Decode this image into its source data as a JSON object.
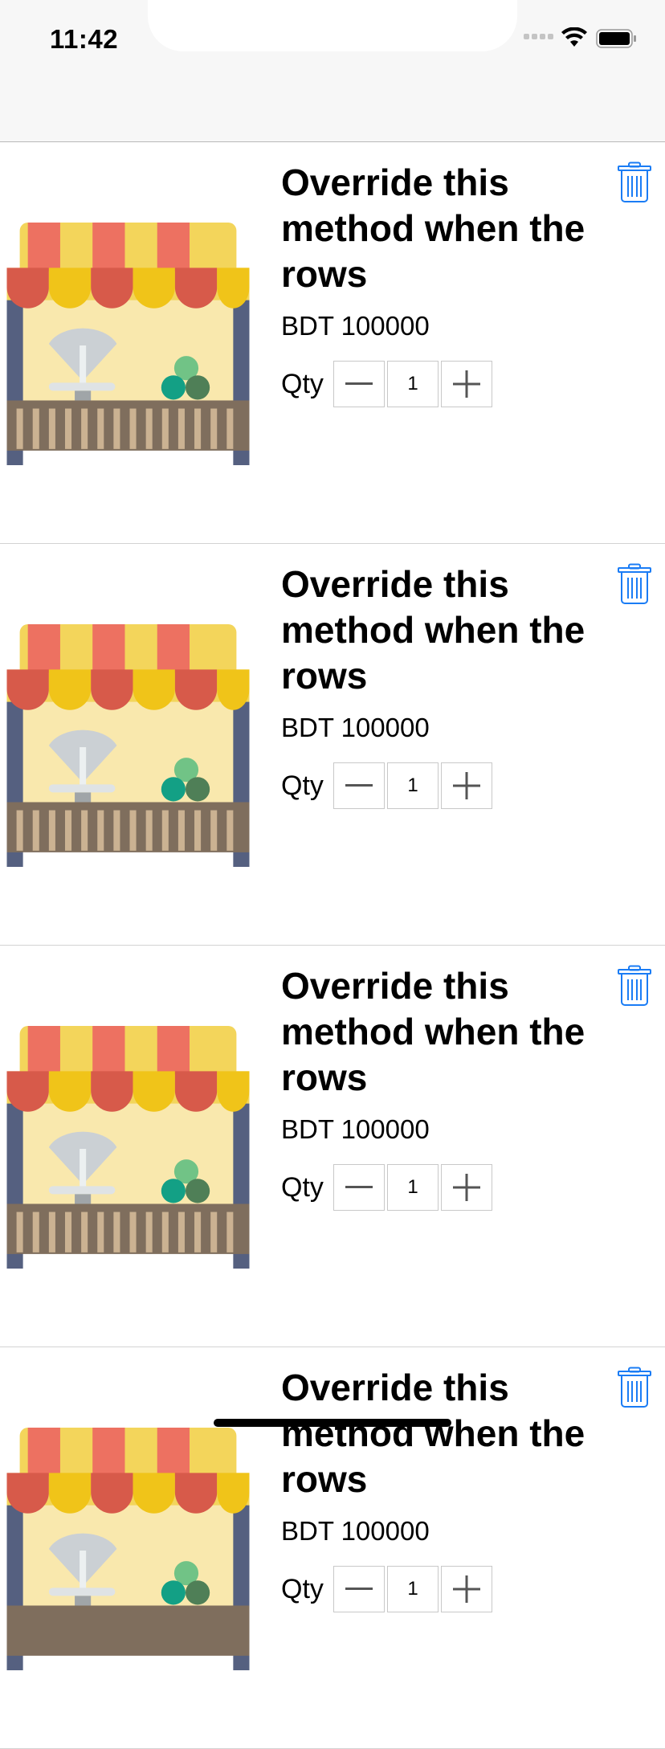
{
  "status_bar": {
    "time": "11:42"
  },
  "cart": {
    "currency_label": "BDT",
    "items": [
      {
        "title": "Override this method when the rows",
        "price": "BDT 100000",
        "qty_label": "Qty",
        "qty": "1"
      },
      {
        "title": "Override this method when the rows",
        "price": "BDT 100000",
        "qty_label": "Qty",
        "qty": "1"
      },
      {
        "title": "Override this method when the rows",
        "price": "BDT 100000",
        "qty_label": "Qty",
        "qty": "1"
      },
      {
        "title": "Override this method when the rows",
        "price": "BDT 100000",
        "qty_label": "Qty",
        "qty": "1"
      }
    ]
  },
  "colors": {
    "accent": "#1a7cf5",
    "divider": "#d3d3d3"
  },
  "icons": {
    "delete": "trash-icon",
    "decrease": "minus-icon",
    "increase": "plus-icon",
    "product": "market-stall-icon"
  }
}
